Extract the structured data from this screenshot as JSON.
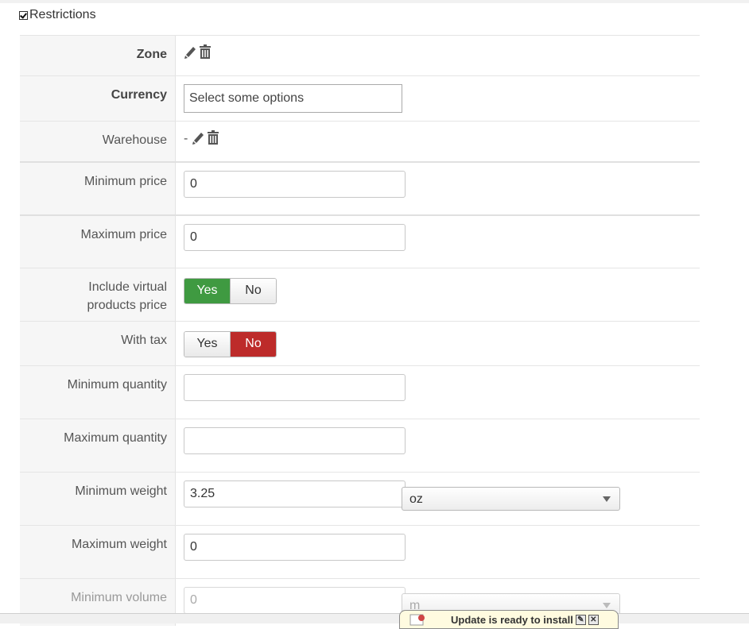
{
  "restrictions": {
    "legend": "Restrictions",
    "checked": true
  },
  "zone": {
    "label": "Zone"
  },
  "currency": {
    "label": "Currency",
    "placeholder": "Select some options"
  },
  "warehouse": {
    "label": "Warehouse",
    "value": "-"
  },
  "min_price": {
    "label": "Minimum price",
    "value": "0"
  },
  "max_price": {
    "label": "Maximum price",
    "value": "0"
  },
  "include_virtual": {
    "label_line1": "Include virtual",
    "label_line2": "products price",
    "yes": "Yes",
    "no": "No",
    "selected": "Yes"
  },
  "with_tax": {
    "label": "With tax",
    "yes": "Yes",
    "no": "No",
    "selected": "No"
  },
  "min_quantity": {
    "label": "Minimum quantity",
    "value": ""
  },
  "max_quantity": {
    "label": "Maximum quantity",
    "value": ""
  },
  "min_weight": {
    "label": "Minimum weight",
    "value": "3.25",
    "unit": "oz"
  },
  "max_weight": {
    "label": "Maximum weight",
    "value": "0"
  },
  "min_volume": {
    "label": "Minimum volume",
    "value": "0",
    "unit": "m"
  },
  "update_notice": {
    "text": "Update is ready to install"
  },
  "colors": {
    "yes_active": "#3f9a41",
    "no_active": "#bd2b2a",
    "label_bg": "#f6f6f6",
    "notice_bg": "#fffbe0"
  },
  "icons": {
    "edit": "pencil-icon",
    "delete": "trash-icon"
  }
}
